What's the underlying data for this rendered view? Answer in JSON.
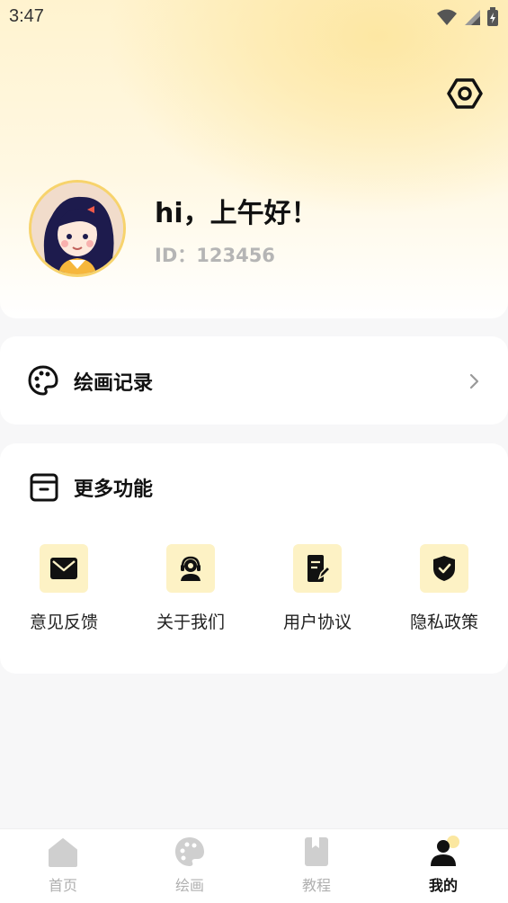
{
  "status_bar": {
    "time": "3:47"
  },
  "profile": {
    "greeting": "hi，上午好！",
    "id_text": "ID：123456"
  },
  "records": {
    "label": "绘画记录"
  },
  "more": {
    "title": "更多功能",
    "items": [
      {
        "label": "意见反馈",
        "icon": "mail-icon"
      },
      {
        "label": "关于我们",
        "icon": "support-agent-icon"
      },
      {
        "label": "用户协议",
        "icon": "document-edit-icon"
      },
      {
        "label": "隐私政策",
        "icon": "shield-check-icon"
      }
    ]
  },
  "tabs": [
    {
      "label": "首页",
      "icon": "home-icon"
    },
    {
      "label": "绘画",
      "icon": "palette-icon"
    },
    {
      "label": "教程",
      "icon": "book-icon"
    },
    {
      "label": "我的",
      "icon": "user-icon",
      "active": true
    }
  ],
  "colors": {
    "accent": "#f7d36c",
    "icon_bg": "#fdf2c5",
    "muted": "#b0b0b0"
  }
}
